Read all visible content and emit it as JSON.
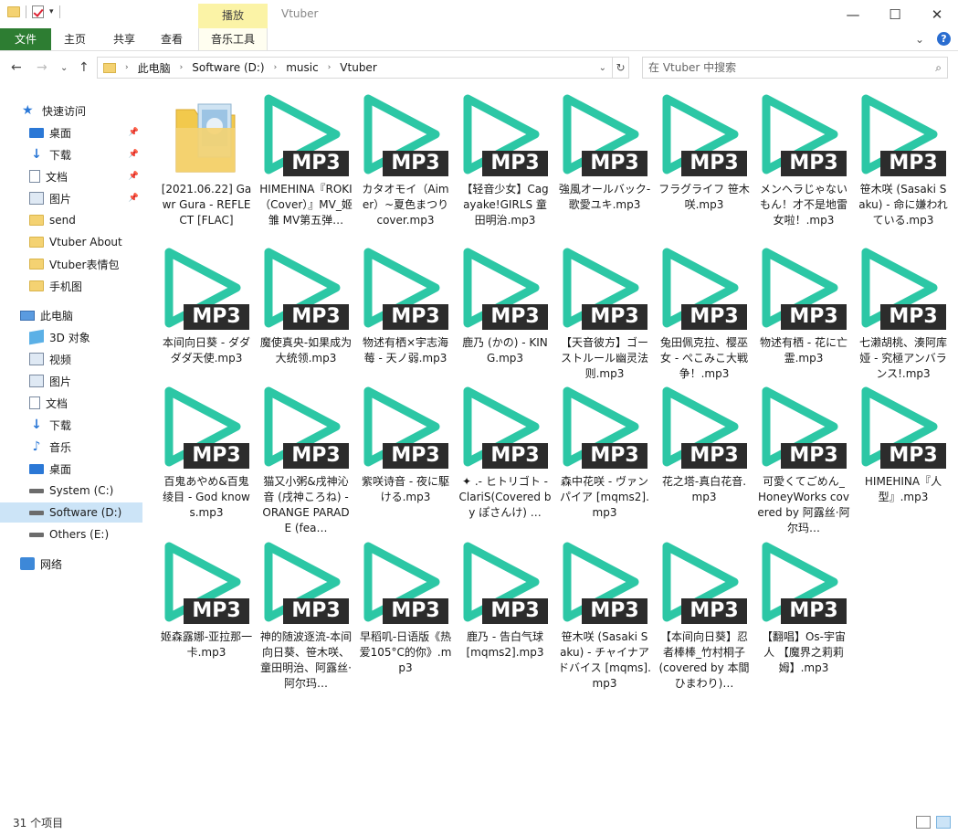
{
  "window": {
    "title": "Vtuber",
    "context_tab": "播放",
    "controls": {
      "minimize": "—",
      "maximize": "☐",
      "close": "✕"
    }
  },
  "ribbon": {
    "file": "文件",
    "tabs": [
      "主页",
      "共享",
      "查看",
      "音乐工具"
    ]
  },
  "address": {
    "crumbs": [
      "此电脑",
      "Software (D:)",
      "music",
      "Vtuber"
    ],
    "search_placeholder": "在 Vtuber 中搜索"
  },
  "sidebar": {
    "quick_access": "快速访问",
    "items": [
      {
        "label": "快速访问",
        "icon": "star-icon"
      },
      {
        "label": "桌面",
        "icon": "desktop-icon",
        "pinned": true
      },
      {
        "label": "下载",
        "icon": "download-icon",
        "pinned": true
      },
      {
        "label": "文档",
        "icon": "document-icon",
        "pinned": true
      },
      {
        "label": "图片",
        "icon": "picture-icon",
        "pinned": true
      },
      {
        "label": "send",
        "icon": "folder-icon"
      },
      {
        "label": "Vtuber About",
        "icon": "folder-icon"
      },
      {
        "label": "Vtuber表情包",
        "icon": "folder-icon"
      },
      {
        "label": "手机图",
        "icon": "folder-icon"
      },
      {
        "label": "此电脑",
        "icon": "pc-icon"
      },
      {
        "label": "3D 对象",
        "icon": "3d-objects-icon"
      },
      {
        "label": "视频",
        "icon": "video-icon"
      },
      {
        "label": "图片",
        "icon": "picture-icon"
      },
      {
        "label": "文档",
        "icon": "document-icon"
      },
      {
        "label": "下载",
        "icon": "download-icon"
      },
      {
        "label": "音乐",
        "icon": "music-icon"
      },
      {
        "label": "桌面",
        "icon": "desktop-icon"
      },
      {
        "label": "System (C:)",
        "icon": "drive-icon"
      },
      {
        "label": "Software (D:)",
        "icon": "drive-icon",
        "selected": true
      },
      {
        "label": "Others (E:)",
        "icon": "drive-icon"
      },
      {
        "label": "网络",
        "icon": "network-icon"
      }
    ]
  },
  "files": [
    {
      "name": "[2021.06.22] Gawr Gura - REFLECT [FLAC]",
      "type": "folder"
    },
    {
      "name": "HIMEHINA『ROKI（Cover）』MV_姬雏 MV第五弹…",
      "type": "mp3"
    },
    {
      "name": "カタオモイ（Aimer）~夏色まつり cover.mp3",
      "type": "mp3"
    },
    {
      "name": "【轻音少女】Cagayake!GIRLS 童田明治.mp3",
      "type": "mp3"
    },
    {
      "name": "強風オールバック-歌愛ユキ.mp3",
      "type": "mp3"
    },
    {
      "name": "フラグライフ 笹木咲.mp3",
      "type": "mp3"
    },
    {
      "name": "メンヘラじゃないもん！才不是地雷女啦！.mp3",
      "type": "mp3"
    },
    {
      "name": "笹木咲 (Sasaki Saku) - 命に嫌われている.mp3",
      "type": "mp3"
    },
    {
      "name": "本间向日葵 - ダダダダ天使.mp3",
      "type": "mp3"
    },
    {
      "name": "魔使真央-如果成为大统领.mp3",
      "type": "mp3"
    },
    {
      "name": "物述有栖×宇志海莓 - 天ノ弱.mp3",
      "type": "mp3"
    },
    {
      "name": "鹿乃 (かの) - KING.mp3",
      "type": "mp3"
    },
    {
      "name": "【天音彼方】ゴーストルール幽灵法则.mp3",
      "type": "mp3"
    },
    {
      "name": "兔田佩克拉、樱巫女 - ぺこみこ大戦争！.mp3",
      "type": "mp3"
    },
    {
      "name": "物述有栖 - 花に亡霊.mp3",
      "type": "mp3"
    },
    {
      "name": "七濑胡桃、湊阿库娅 - 究極アンバランス!.mp3",
      "type": "mp3"
    },
    {
      "name": "百鬼あやめ&百鬼绫目 - God knows.mp3",
      "type": "mp3"
    },
    {
      "name": "猫又小粥&戌神沁音 (戌神ころね) - ORANGE PARADE (fea…",
      "type": "mp3"
    },
    {
      "name": "紫咲诗音 - 夜に駆ける.mp3",
      "type": "mp3"
    },
    {
      "name": "✦ .- ヒトリゴト - ClariS(Covered by ぽさんけ) …",
      "type": "mp3"
    },
    {
      "name": "森中花咲 - ヴァンパイア [mqms2].mp3",
      "type": "mp3"
    },
    {
      "name": "花之塔-真白花音.mp3",
      "type": "mp3"
    },
    {
      "name": "可愛くてごめん_ HoneyWorks covered by 阿露丝·阿尔玛…",
      "type": "mp3"
    },
    {
      "name": "HIMEHINA『人型』.mp3",
      "type": "mp3"
    },
    {
      "name": "姬森露娜-亚拉那一卡.mp3",
      "type": "mp3"
    },
    {
      "name": "神的随波逐流-本间向日葵、笹木咲、童田明治、阿露丝·阿尔玛…",
      "type": "mp3"
    },
    {
      "name": "早稻叽-日语版《热爱105°C的你》.mp3",
      "type": "mp3"
    },
    {
      "name": "鹿乃 - 告白气球 [mqms2].mp3",
      "type": "mp3"
    },
    {
      "name": "笹木咲 (Sasaki Saku) - チャイナアドバイス [mqms].mp3",
      "type": "mp3"
    },
    {
      "name": "【本间向日葵】忍者棒棒_竹村桐子 (covered by 本間ひまわり)…",
      "type": "mp3"
    },
    {
      "name": "【翻唱】Os-宇宙人 【魔界之莉莉姆】.mp3",
      "type": "mp3"
    }
  ],
  "mp3_badge": "MP3",
  "colors": {
    "play_icon": "#2cc7a5",
    "badge_bg": "#2c2c2c",
    "file_tab": "#2d7d32",
    "selection": "#cce4f7"
  },
  "status": "31 个项目"
}
